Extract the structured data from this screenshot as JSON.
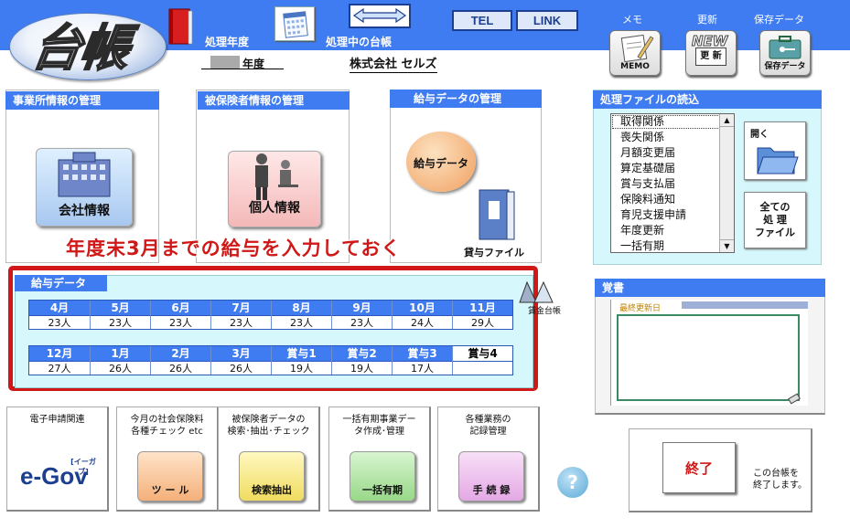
{
  "header": {
    "logo": "台帳",
    "year_label": "処理年度",
    "ledger_label": "処理中の台帳",
    "tel": "TEL",
    "link": "LINK",
    "memo_label": "メモ",
    "memo_caption": "MEMO",
    "update_label": "更新",
    "update_badge": "NEW",
    "update_caption": "更 新",
    "save_label": "保存データ",
    "save_caption": "保存データ",
    "year_suffix": "年度",
    "company": "株式会社  セルズ"
  },
  "panels": {
    "office": {
      "title": "事業所情報の管理",
      "button": "会社情報"
    },
    "insured": {
      "title": "被保険者情報の管理",
      "button": "個人情報"
    },
    "salary": {
      "title": "給与データの管理",
      "button": "給与データ",
      "file": "貸与ファイル",
      "ledger": "賃金台帳"
    }
  },
  "annotation": "年度末3月までの給与を入力しておく",
  "salary_data": {
    "title": "給与データ",
    "row1": [
      {
        "m": "4月",
        "v": "23人"
      },
      {
        "m": "5月",
        "v": "23人"
      },
      {
        "m": "6月",
        "v": "23人"
      },
      {
        "m": "7月",
        "v": "23人"
      },
      {
        "m": "8月",
        "v": "23人"
      },
      {
        "m": "9月",
        "v": "23人"
      },
      {
        "m": "10月",
        "v": "24人"
      },
      {
        "m": "11月",
        "v": "29人"
      }
    ],
    "row2": [
      {
        "m": "12月",
        "v": "27人"
      },
      {
        "m": "1月",
        "v": "26人"
      },
      {
        "m": "2月",
        "v": "26人"
      },
      {
        "m": "3月",
        "v": "26人"
      },
      {
        "m": "賞与1",
        "v": "19人"
      },
      {
        "m": "賞与2",
        "v": "19人"
      },
      {
        "m": "賞与3",
        "v": "17人"
      },
      {
        "m": "賞与4",
        "v": ""
      }
    ]
  },
  "file_panel": {
    "title": "処理ファイルの読込",
    "items": [
      "取得関係",
      "喪失関係",
      "月額変更届",
      "算定基礎届",
      "賞与支払届",
      "保険料通知",
      "育児支援申請",
      "年度更新",
      "一括有期"
    ],
    "open": "開く",
    "all_files": [
      "全ての",
      "処 理",
      "ファイル"
    ]
  },
  "memo_panel": {
    "title": "覚書",
    "last_updated": "最終更新日"
  },
  "tiles": [
    {
      "title": [
        "電子申請関連",
        ""
      ],
      "icon_text": "e-Gov",
      "sub": "[イーガブ]"
    },
    {
      "title": [
        "今月の社会保険料",
        "各種チェック  etc"
      ],
      "icon_text": "ツ ー ル"
    },
    {
      "title": [
        "被保険者データの",
        "検索･抽出･チェック"
      ],
      "icon_text": "検索抽出"
    },
    {
      "title": [
        "一括有期事業デー",
        "タ作成･管理"
      ],
      "icon_text": "一括有期"
    },
    {
      "title": [
        "各種業務の",
        "記録管理"
      ],
      "icon_text": "手 続 録"
    }
  ],
  "help": "?",
  "exit": {
    "button": "終了",
    "desc": [
      "この台帳を",
      "終了します。"
    ]
  },
  "colors": {
    "header_blue": "#3f7cf2",
    "annotation_red": "#d01818",
    "salary_bg": "#d6f7fb"
  }
}
